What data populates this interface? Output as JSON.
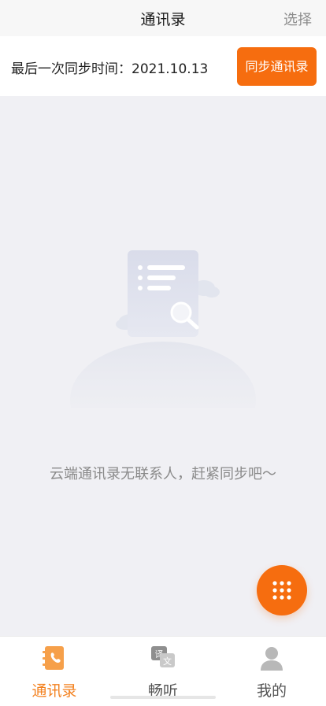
{
  "header": {
    "title": "通讯录",
    "select_label": "选择"
  },
  "sync": {
    "last_sync_label": "最后一次同步时间：2021.10.13",
    "sync_button_label": "同步通讯录"
  },
  "empty_state": {
    "message": "云端通讯录无联系人，赶紧同步吧～",
    "illustration": "empty-contacts-illustration"
  },
  "fab": {
    "icon": "dialpad-icon"
  },
  "tabbar": {
    "items": [
      {
        "label": "通讯录",
        "icon": "contacts-phone-icon",
        "active": true
      },
      {
        "label": "畅听",
        "icon": "translate-icon",
        "active": false
      },
      {
        "label": "我的",
        "icon": "person-icon",
        "active": false
      }
    ]
  },
  "colors": {
    "accent": "#f66d0f",
    "active_tab": "#f3811f",
    "background": "#f0f0f4"
  }
}
